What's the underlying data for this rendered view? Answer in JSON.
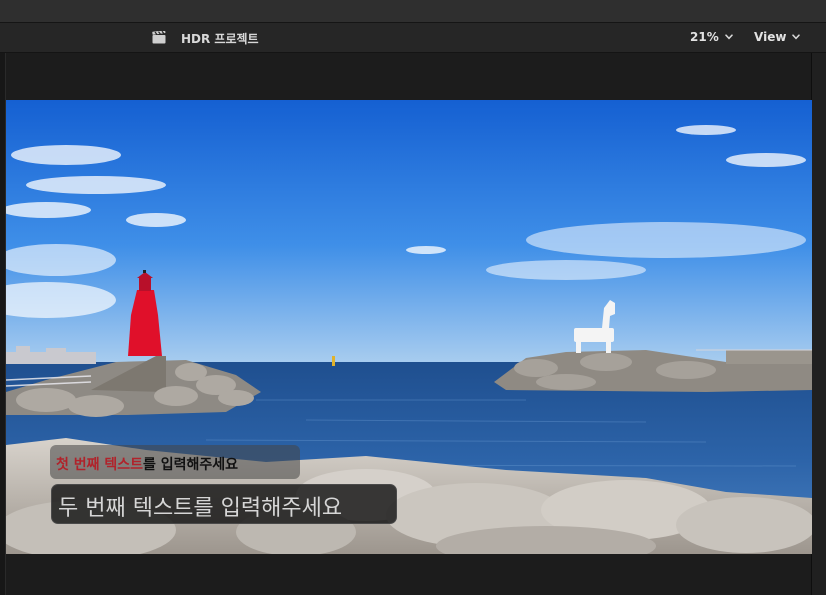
{
  "toolbar": {
    "project_icon": "clapperboard-icon",
    "project_name": "HDR 프로젝트",
    "zoom_level": "21%",
    "view_label": "View"
  },
  "viewer": {
    "captions": {
      "first_highlight": "첫 번째 텍스트",
      "first_rest": "를 입력해주세요",
      "second": "두 번째 텍스트를 입력해주세요"
    }
  },
  "colors": {
    "first_caption_highlight": "#b0232b",
    "sky": "#1e6fd6",
    "sea": "#2c63a8"
  }
}
